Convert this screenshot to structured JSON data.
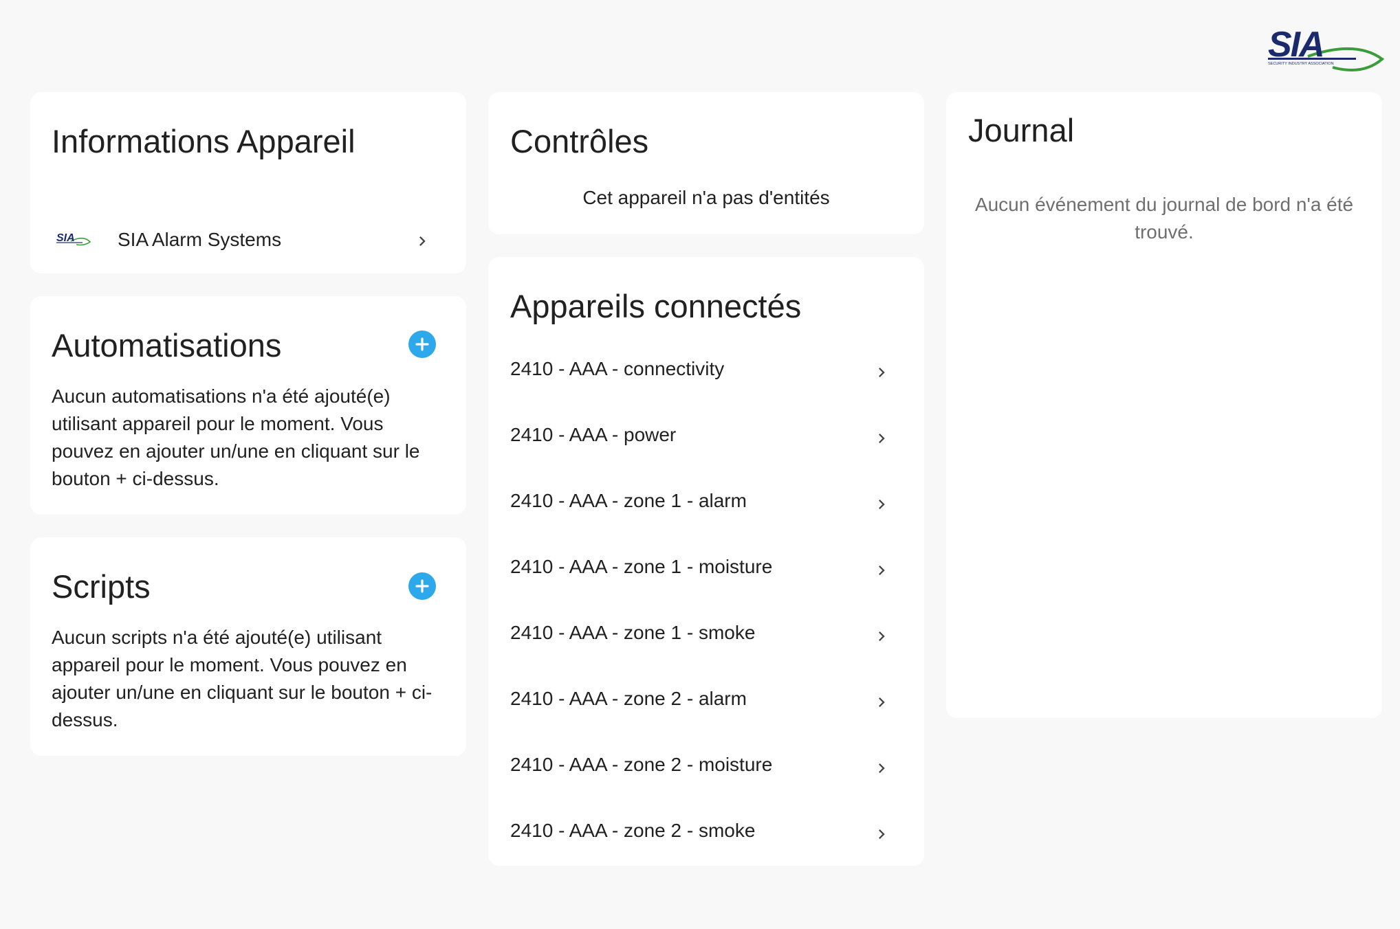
{
  "brand": {
    "logo_text": "SIA",
    "logo_subtext": "SECURITY INDUSTRY ASSOCIATION",
    "navy": "#1b2a6b",
    "green": "#3a9d3a"
  },
  "colors": {
    "background": "#f8f8f8",
    "card": "#ffffff",
    "accent": "#2da8ea",
    "muted_text": "#6f6f6f"
  },
  "device_info": {
    "title": "Informations Appareil",
    "integration": {
      "icon": "sia-logo-icon",
      "label": "SIA Alarm Systems"
    }
  },
  "automations": {
    "title": "Automatisations",
    "add_icon": "plus-icon",
    "empty_text": "Aucun automatisations n'a été ajouté(e) utilisant appareil pour le moment. Vous pouvez en ajouter un/une en cliquant sur le bouton + ci-dessus."
  },
  "scripts": {
    "title": "Scripts",
    "add_icon": "plus-icon",
    "empty_text": "Aucun scripts n'a été ajouté(e) utilisant appareil pour le moment. Vous pouvez en ajouter un/une en cliquant sur le bouton + ci-dessus."
  },
  "controls": {
    "title": "Contrôles",
    "empty_text": "Cet appareil n'a pas d'entités"
  },
  "connected_devices": {
    "title": "Appareils connectés",
    "items": [
      {
        "label": "2410 - AAA - connectivity"
      },
      {
        "label": "2410 - AAA - power"
      },
      {
        "label": "2410 - AAA - zone 1 - alarm"
      },
      {
        "label": "2410 - AAA - zone 1 - moisture"
      },
      {
        "label": "2410 - AAA - zone 1 - smoke"
      },
      {
        "label": "2410 - AAA - zone 2 - alarm"
      },
      {
        "label": "2410 - AAA - zone 2 - moisture"
      },
      {
        "label": "2410 - AAA - zone 2 - smoke"
      }
    ]
  },
  "logbook": {
    "title": "Journal",
    "empty_text": "Aucun événement du journal de bord n'a été trouvé."
  }
}
